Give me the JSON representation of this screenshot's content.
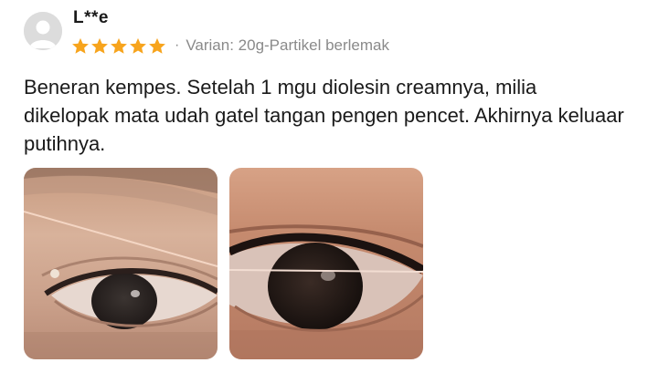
{
  "review": {
    "username": "L**e",
    "rating": 5,
    "rating_max": 5,
    "star_color": "#f7a41d",
    "separator": "·",
    "variant": "Varian: 20g-Partikel berlemak",
    "text": "Beneran kempes. Setelah 1 mgu diolesin creamnya, milia dikelopak mata udah gatel tangan pengen pencet. Akhirnya keluaar putihnya.",
    "avatar_icon": "default-user-avatar-icon",
    "photos": [
      {
        "subject": "eye closeup before"
      },
      {
        "subject": "eye closeup after"
      }
    ]
  }
}
